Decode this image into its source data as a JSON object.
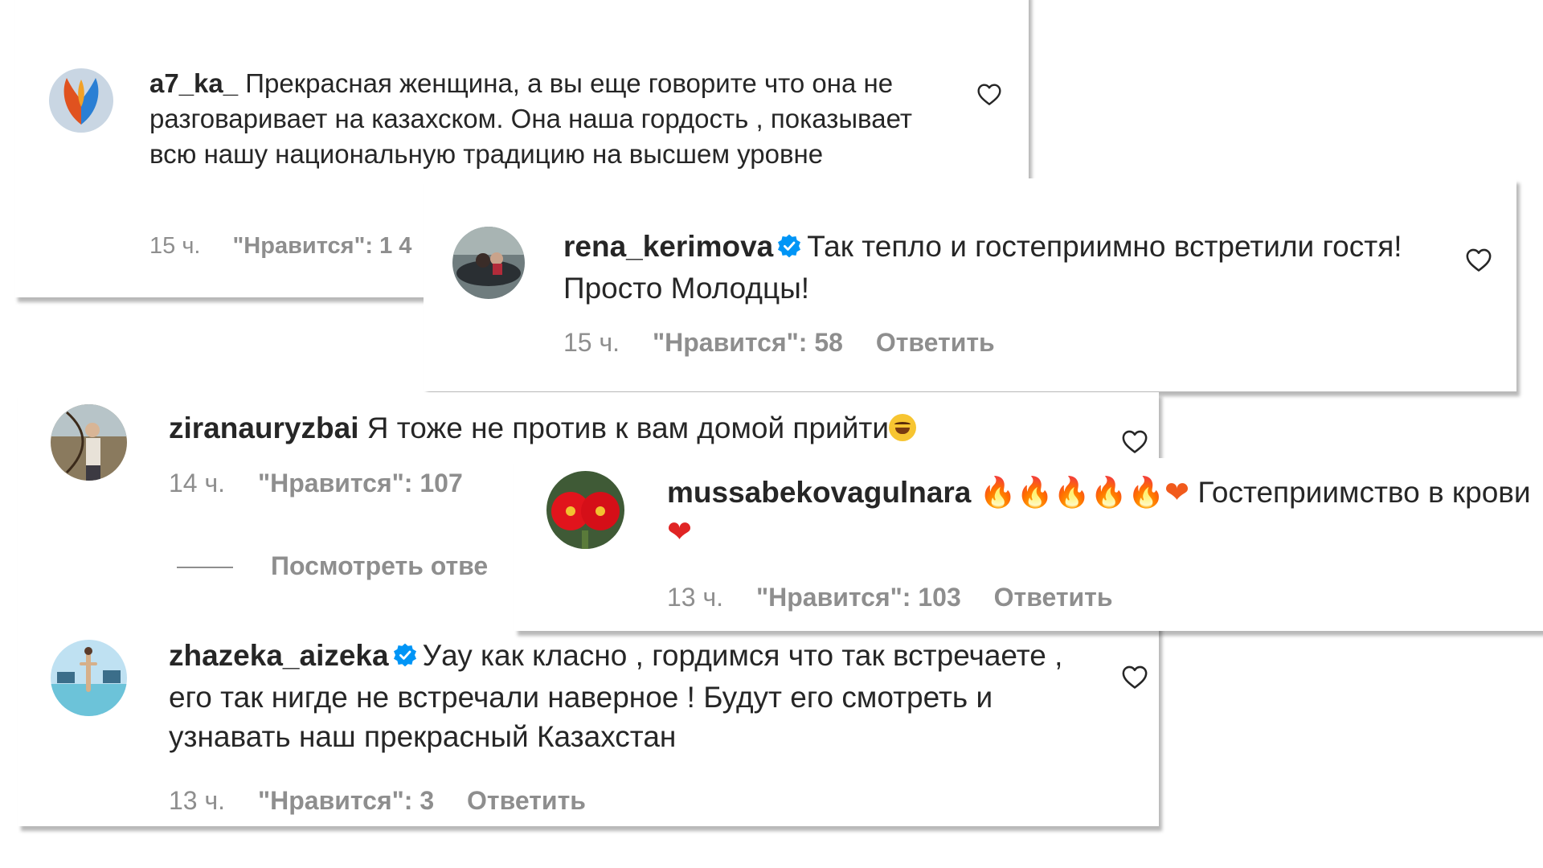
{
  "colors": {
    "text": "#262626",
    "meta": "#8e8e8e",
    "verified": "#0095f6",
    "background": "#ffffff"
  },
  "comments": [
    {
      "username": "a7_ka_",
      "verified": false,
      "text": "Прекрасная женщина, а вы еще говорите что она не разговаривает на казахском. Она наша гордость , показывает всю нашу национальную традицию на высшем уровне",
      "time": "15 ч.",
      "likes": "\"Нравится\": 1 4",
      "avatar_icon": "phoenix-avatar-icon"
    },
    {
      "username": "rena_kerimova",
      "verified": true,
      "text": "Так тепло и гостеприимно встретили гостя! Просто Молодцы!",
      "time": "15 ч.",
      "likes": "\"Нравится\": 58",
      "reply": "Ответить",
      "avatar_icon": "car-photo-avatar-icon"
    },
    {
      "username": "ziranauryzbai",
      "verified": false,
      "text": "Я тоже не против к вам домой прийти",
      "emoji": "laughing-tears-emoji",
      "time": "14 ч.",
      "likes": "\"Нравится\": 107",
      "view_replies": "Посмотреть отве",
      "avatar_icon": "archer-avatar-icon"
    },
    {
      "username": "mussabekovagulnara",
      "verified": false,
      "emoji_prefix": "🔥🔥🔥🔥🔥❤",
      "text": "Гостеприимство в крови",
      "emoji_suffix": "❤",
      "time": "13 ч.",
      "likes": "\"Нравится\": 103",
      "reply": "Ответить",
      "avatar_icon": "red-flowers-avatar-icon"
    },
    {
      "username": "zhazeka_aizeka",
      "verified": true,
      "text": "Уау как класно , гордимся что так встречаете , его так нигде не встречали наверное ! Будут его смотреть и узнавать наш прекрасный Казахстан",
      "time": "13 ч.",
      "likes": "\"Нравится\": 3",
      "reply": "Ответить",
      "avatar_icon": "yoga-beach-avatar-icon"
    }
  ]
}
